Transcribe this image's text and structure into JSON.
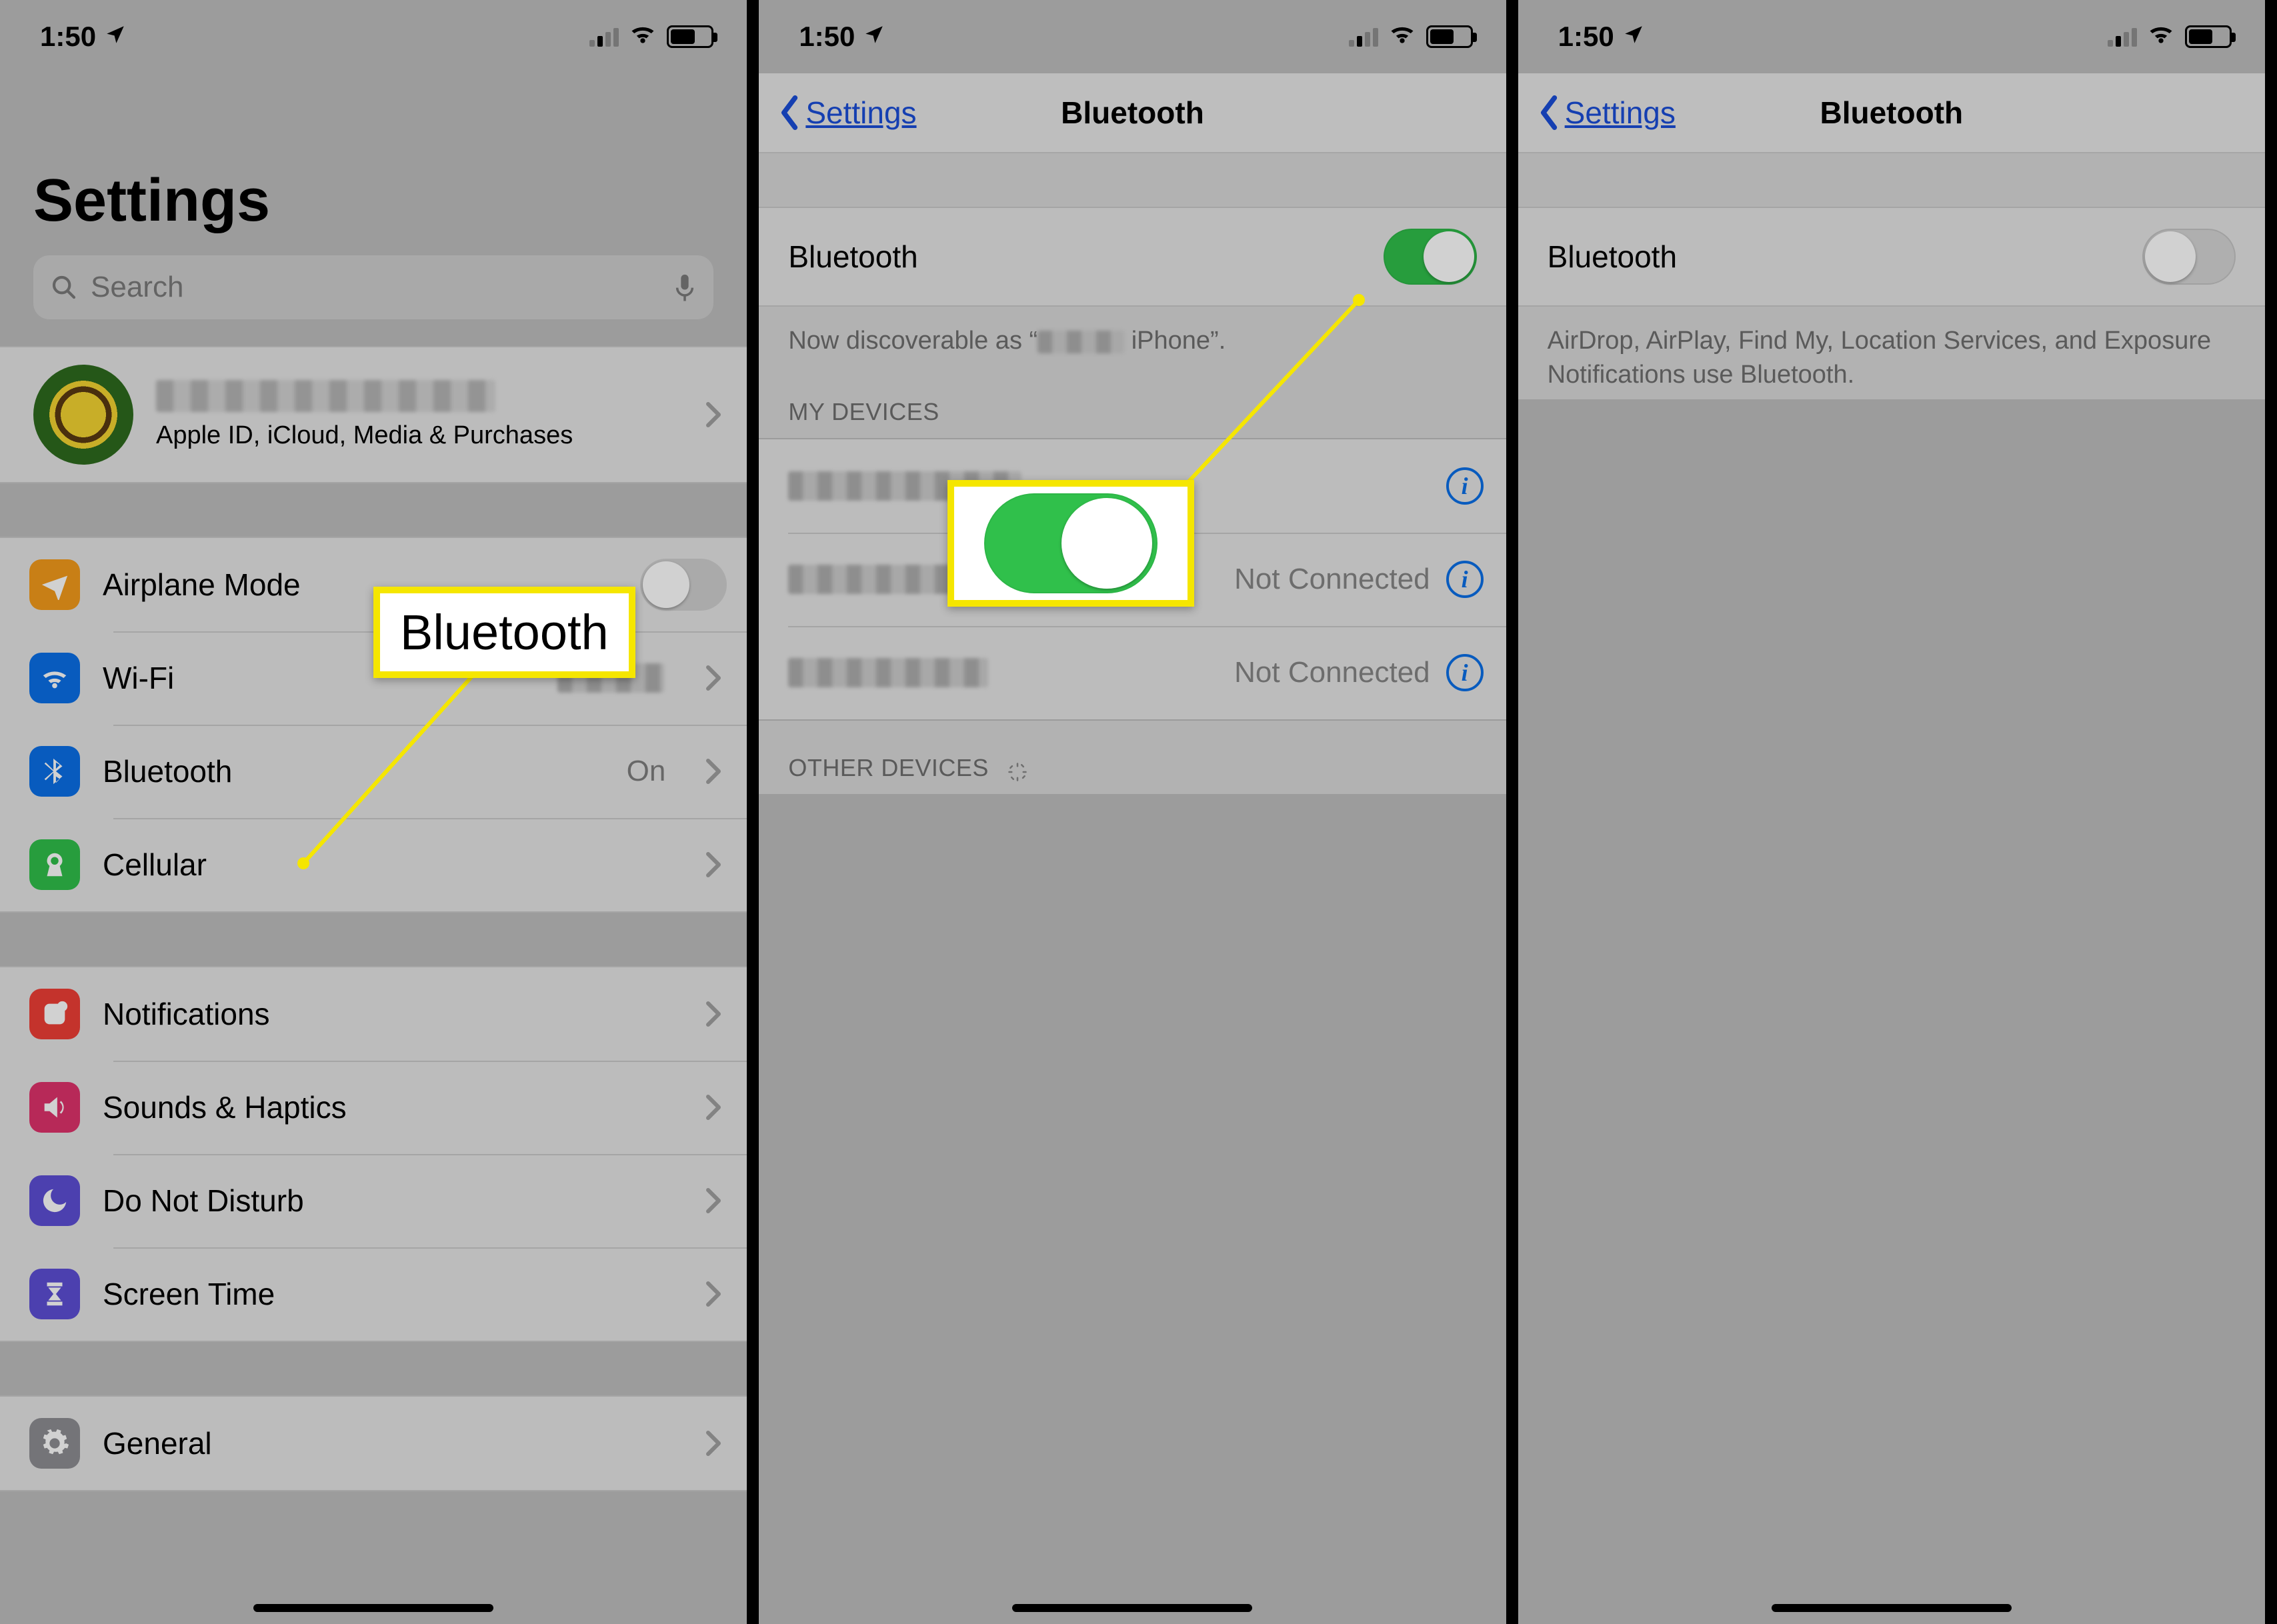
{
  "status": {
    "time": "1:50"
  },
  "pane1": {
    "title": "Settings",
    "search_placeholder": "Search",
    "profile_sub": "Apple ID, iCloud, Media & Purchases",
    "rows": {
      "airplane": "Airplane Mode",
      "wifi": "Wi-Fi",
      "bluetooth": "Bluetooth",
      "bluetooth_value": "On",
      "cellular": "Cellular",
      "notifications": "Notifications",
      "sounds": "Sounds & Haptics",
      "dnd": "Do Not Disturb",
      "screentime": "Screen Time",
      "general": "General"
    },
    "callout_label": "Bluetooth",
    "icon_colors": {
      "airplane": "#f59b1c",
      "wifi": "#0a6fe8",
      "bluetooth": "#0a6fe8",
      "cellular": "#30c04b",
      "notifications": "#ef3f36",
      "sounds": "#e0336c",
      "dnd": "#5d4fd6",
      "screentime": "#5d4fd6",
      "general": "#8e8e93"
    }
  },
  "pane2": {
    "back": "Settings",
    "title": "Bluetooth",
    "bt_label": "Bluetooth",
    "discover_prefix": "Now discoverable as “",
    "discover_suffix": " iPhone”.",
    "my_devices": "MY DEVICES",
    "other_devices": "OTHER DEVICES",
    "not_connected": "Not Connected",
    "devices_status": [
      "",
      "Not Connected",
      "Not Connected"
    ]
  },
  "pane3": {
    "back": "Settings",
    "title": "Bluetooth",
    "bt_label": "Bluetooth",
    "note": "AirDrop, AirPlay, Find My, Location Services, and Exposure Notifications use Bluetooth."
  }
}
